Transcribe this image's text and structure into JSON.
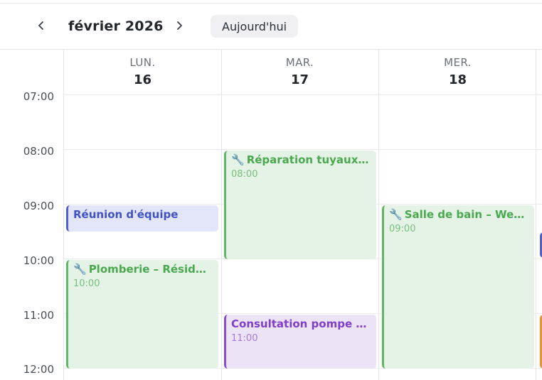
{
  "toolbar": {
    "month_label": "février 2026",
    "today_label": "Aujourd'hui",
    "prev_icon": "chevron-left-icon",
    "next_icon": "chevron-right-icon"
  },
  "days": [
    {
      "name": "LUN.",
      "number": "16"
    },
    {
      "name": "MAR.",
      "number": "17"
    },
    {
      "name": "MER.",
      "number": "18"
    }
  ],
  "time_labels": [
    "07:00",
    "08:00",
    "09:00",
    "10:00",
    "11:00",
    "12:00"
  ],
  "events": {
    "mon_meeting": {
      "title": "Réunion d'équipe"
    },
    "mon_plumbing": {
      "icon": "wrench-icon",
      "icon_glyph": "🔧",
      "title": "Plomberie – Réside...",
      "time": "10:00"
    },
    "tue_repair": {
      "icon": "wrench-icon",
      "icon_glyph": "🔧",
      "title": "Réparation tuyaux –...",
      "time": "08:00"
    },
    "tue_consult": {
      "title": "Consultation pompe à ...",
      "time": "11:00"
    },
    "wed_bathroom": {
      "icon": "wrench-icon",
      "icon_glyph": "🔧",
      "title": "Salle de bain – Weber",
      "time": "09:00"
    }
  },
  "colors": {
    "green": "#5fb864",
    "blue": "#4d5fd1",
    "purple": "#8a4bd0",
    "orange": "#f0912f"
  }
}
